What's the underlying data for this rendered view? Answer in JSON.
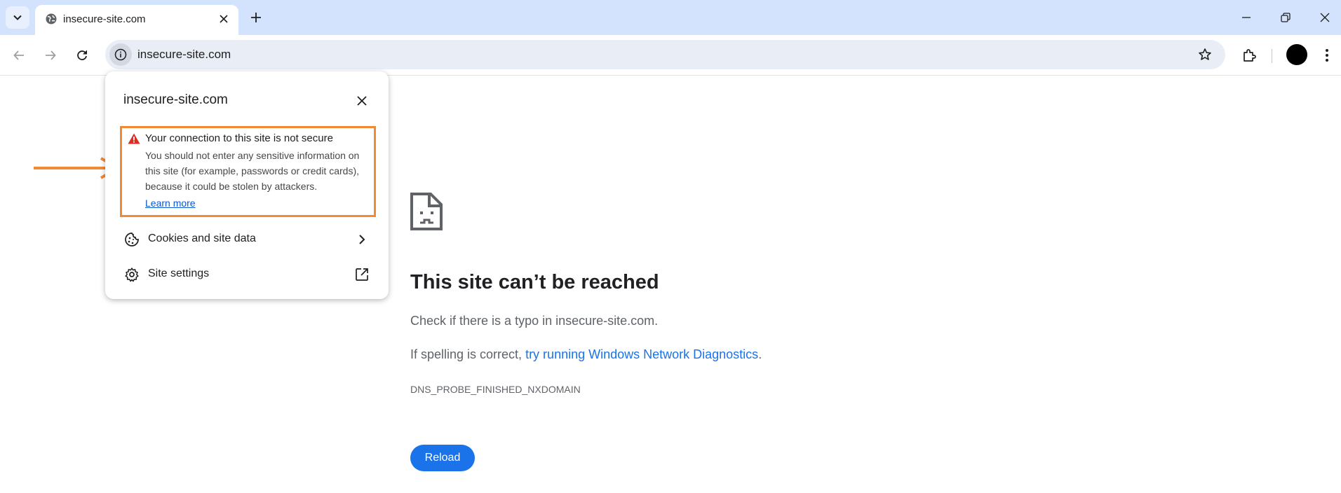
{
  "tabstrip": {
    "tab_title": "insecure-site.com",
    "icons": {
      "search": "chevron-down-icon",
      "favicon": "globe-icon",
      "close": "close-icon",
      "new_tab": "plus-icon"
    }
  },
  "window_controls": [
    "minimize-icon",
    "restore-icon",
    "close-icon"
  ],
  "toolbar": {
    "url": "insecure-site.com",
    "icons": [
      "back-arrow-icon",
      "forward-arrow-icon",
      "reload-icon",
      "info-icon",
      "star-icon",
      "extensions-icon",
      "avatar",
      "more-vert-icon"
    ]
  },
  "popup": {
    "title": "insecure-site.com",
    "warning": {
      "title": "Your connection to this site is not secure",
      "body": "You should not enter any sensitive information on this site (for example, passwords or credit cards), because it could be stolen by attackers.",
      "learn_more": "Learn more"
    },
    "rows": [
      {
        "label": "Cookies and site data",
        "icon": "cookie-icon",
        "end_icon": "chevron-right-icon"
      },
      {
        "label": "Site settings",
        "icon": "gear-icon",
        "end_icon": "open-external-icon"
      }
    ],
    "highlight_color": "#f08a33"
  },
  "error_page": {
    "title": "This site can’t be reached",
    "line1": "Check if there is a typo in insecure-site.com.",
    "line2_prefix": "If spelling is correct, ",
    "line2_link": "try running Windows Network Diagnostics",
    "line2_suffix": ".",
    "code": "DNS_PROBE_FINISHED_NXDOMAIN",
    "reload_label": "Reload",
    "icon": "sad-page-icon"
  },
  "colors": {
    "tabstrip_bg": "#d3e3fd",
    "link": "#1a73e8",
    "reload_button": "#1a73e8",
    "warning_red": "#d93025",
    "annotation_orange": "#f08a33"
  }
}
